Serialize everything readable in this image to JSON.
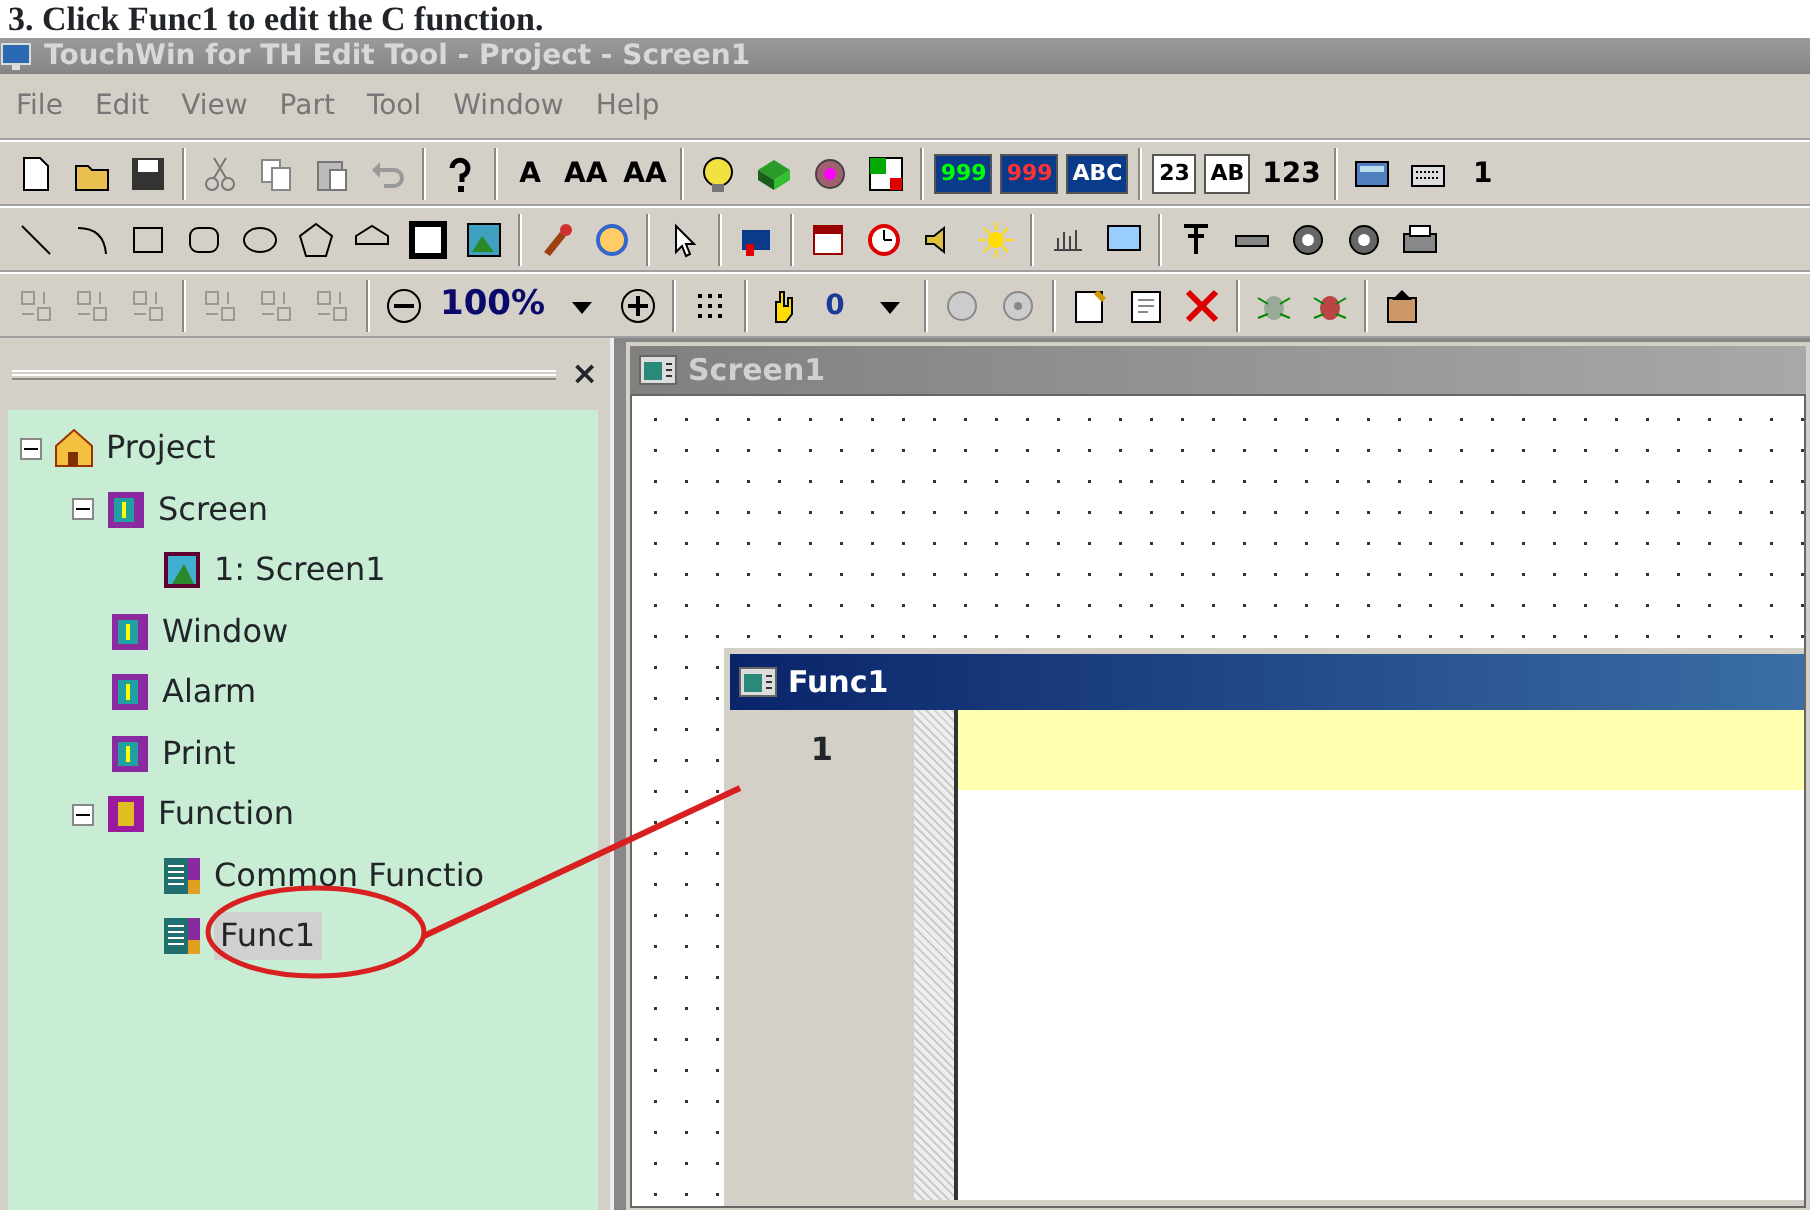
{
  "caption": "3. Click Func1 to edit the C function.",
  "window": {
    "title": "TouchWin for TH Edit Tool - Project - Screen1"
  },
  "menu": [
    "File",
    "Edit",
    "View",
    "Part",
    "Tool",
    "Window",
    "Help"
  ],
  "toolbar_texts": [
    "A",
    "AA",
    "AA",
    "999",
    "999",
    "ABC",
    "23",
    "AB",
    "123",
    "1",
    "100%",
    "0"
  ],
  "project_panel": {
    "close": "×",
    "tree": [
      {
        "label": "Project",
        "kind": "project",
        "expanded": true,
        "selected": false,
        "children": [
          {
            "label": "Screen",
            "kind": "folder",
            "expanded": true,
            "selected": false,
            "children": [
              {
                "label": "1: Screen1",
                "kind": "screen",
                "selected": false
              }
            ]
          },
          {
            "label": "Window",
            "kind": "folder",
            "selected": false
          },
          {
            "label": "Alarm",
            "kind": "folder",
            "selected": false
          },
          {
            "label": "Print",
            "kind": "folder",
            "selected": false
          },
          {
            "label": "Function",
            "kind": "function",
            "expanded": true,
            "selected": false,
            "children": [
              {
                "label": "Common Functio",
                "kind": "code",
                "selected": false
              },
              {
                "label": "Func1",
                "kind": "code",
                "selected": true
              }
            ]
          }
        ]
      }
    ]
  },
  "screen_window": {
    "title": "Screen1"
  },
  "editor": {
    "title": "Func1",
    "lines": [
      {
        "number": "1",
        "current": true
      }
    ]
  }
}
